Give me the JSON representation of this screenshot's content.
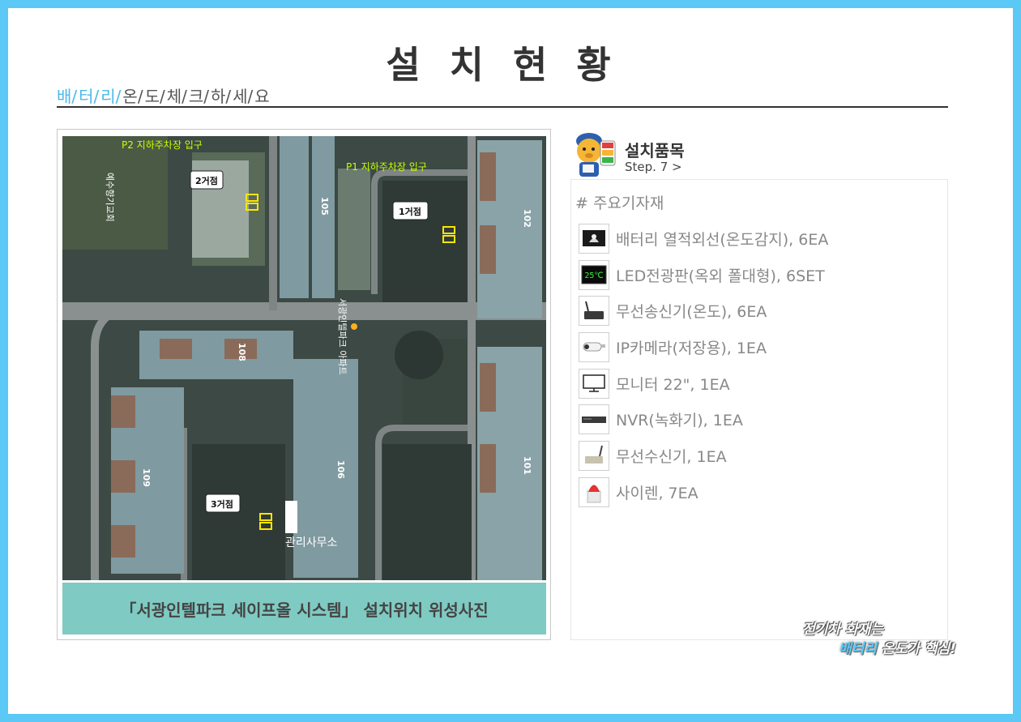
{
  "page": {
    "title": "설 치 현 황",
    "subnav": [
      {
        "text": "배/",
        "highlight": true
      },
      {
        "text": "터/",
        "highlight": true
      },
      {
        "text": "리/",
        "highlight": true
      },
      {
        "text": "온/",
        "highlight": false
      },
      {
        "text": "도/",
        "highlight": false
      },
      {
        "text": "체/",
        "highlight": false
      },
      {
        "text": "크/",
        "highlight": false
      },
      {
        "text": "하/",
        "highlight": false
      },
      {
        "text": "세/",
        "highlight": false
      },
      {
        "text": "요",
        "highlight": false
      }
    ]
  },
  "map": {
    "labels": {
      "p2_entrance": "P2 지하주차장 입구",
      "p1_entrance": "P1 지하주차장 입구",
      "site1": "1거점",
      "site2": "2거점",
      "site3": "3거점",
      "office": "관리사무소",
      "bldg_105": "105",
      "bldg_102": "102",
      "bldg_108": "108",
      "bldg_106": "106",
      "bldg_109": "109",
      "bldg_101": "101",
      "apt_name": "서광인텔파크 아파트",
      "church": "예수향기교회"
    },
    "caption": "「서광인텔파크 세이프올 시스템」 설치위치 위성사진"
  },
  "section": {
    "title": "설치품목",
    "step": "Step. 7 >",
    "mascot_icon": "mascot-icon"
  },
  "equipment": {
    "heading": "# 주요기자재",
    "items": [
      {
        "label": "배터리 열적외선(온도감지), 6EA",
        "icon": "thermal-camera-icon"
      },
      {
        "label": "LED전광판(옥외 폴대형), 6SET",
        "icon": "led-display-icon",
        "display_text": "25℃"
      },
      {
        "label": "무선송신기(온도), 6EA",
        "icon": "wireless-transmitter-icon"
      },
      {
        "label": "IP카메라(저장용), 1EA",
        "icon": "ip-camera-icon"
      },
      {
        "label": "모니터 22\", 1EA",
        "icon": "monitor-icon"
      },
      {
        "label": "NVR(녹화기), 1EA",
        "icon": "nvr-icon"
      },
      {
        "label": "무선수신기, 1EA",
        "icon": "wireless-receiver-icon"
      },
      {
        "label": "사이렌, 7EA",
        "icon": "siren-icon"
      }
    ]
  },
  "slogan": {
    "line1": "전기차 화재는",
    "line2a": "배터리",
    "line2b": " 온도가 핵심!"
  },
  "colors": {
    "frame": "#5bc8f5",
    "accent": "#4cb8e8",
    "caption_bg": "#7fcac2",
    "marker": "#ffe600"
  }
}
